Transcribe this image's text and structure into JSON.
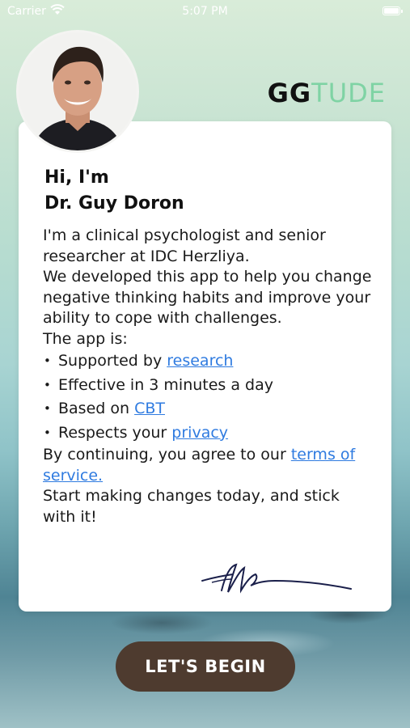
{
  "status_bar": {
    "carrier": "Carrier",
    "time": "5:07 PM"
  },
  "logo": {
    "part1": "GG",
    "part2": "TUDE"
  },
  "intro": {
    "greeting_line1": "Hi, I'm",
    "greeting_line2": "Dr. Guy Doron",
    "para1": "I'm a clinical psychologist and senior researcher at IDC Herzliya.",
    "para2": "We developed this app to help you change negative thinking habits and improve your ability to cope with challenges.",
    "app_is": "The app is:",
    "bullets": [
      {
        "text": "Supported by ",
        "link": "research"
      },
      {
        "text": "Effective in 3 minutes a day",
        "link": ""
      },
      {
        "text": "Based on ",
        "link": "CBT"
      },
      {
        "text": "Respects your ",
        "link": "privacy"
      }
    ],
    "terms_prefix": "By continuing, you agree to our ",
    "terms_link": "terms of service.",
    "closing": "Start making changes today, and stick with it!"
  },
  "cta": {
    "label": "LET'S BEGIN"
  },
  "colors": {
    "accent": "#4e3b2f",
    "link": "#2f7be0",
    "logo_green": "#7fd3a4"
  }
}
